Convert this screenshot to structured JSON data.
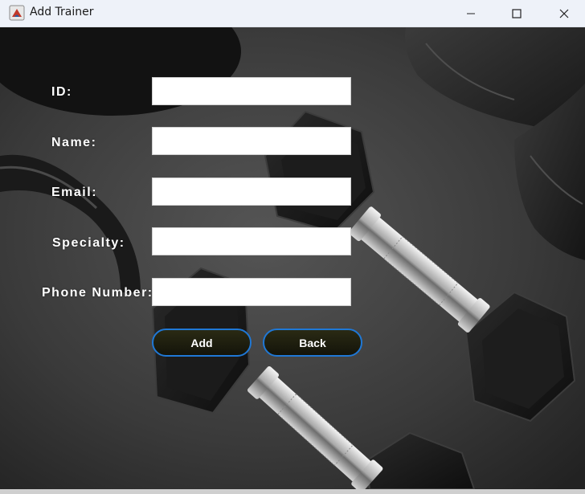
{
  "window": {
    "title": "Add Trainer"
  },
  "form": {
    "fields": [
      {
        "label": "ID:",
        "value": ""
      },
      {
        "label": "Name:",
        "value": ""
      },
      {
        "label": "Email:",
        "value": ""
      },
      {
        "label": "Specialty:",
        "value": ""
      },
      {
        "label": "Phone Number:",
        "value": ""
      }
    ]
  },
  "buttons": {
    "add_label": "Add",
    "back_label": "Back"
  },
  "colors": {
    "button_border": "#1f78d6",
    "button_fill": "#1a1a0d",
    "label_text": "#ffffff"
  },
  "icons": {
    "app": "java-app-icon",
    "minimize": "minimize-icon",
    "maximize": "maximize-icon",
    "close": "close-icon"
  }
}
